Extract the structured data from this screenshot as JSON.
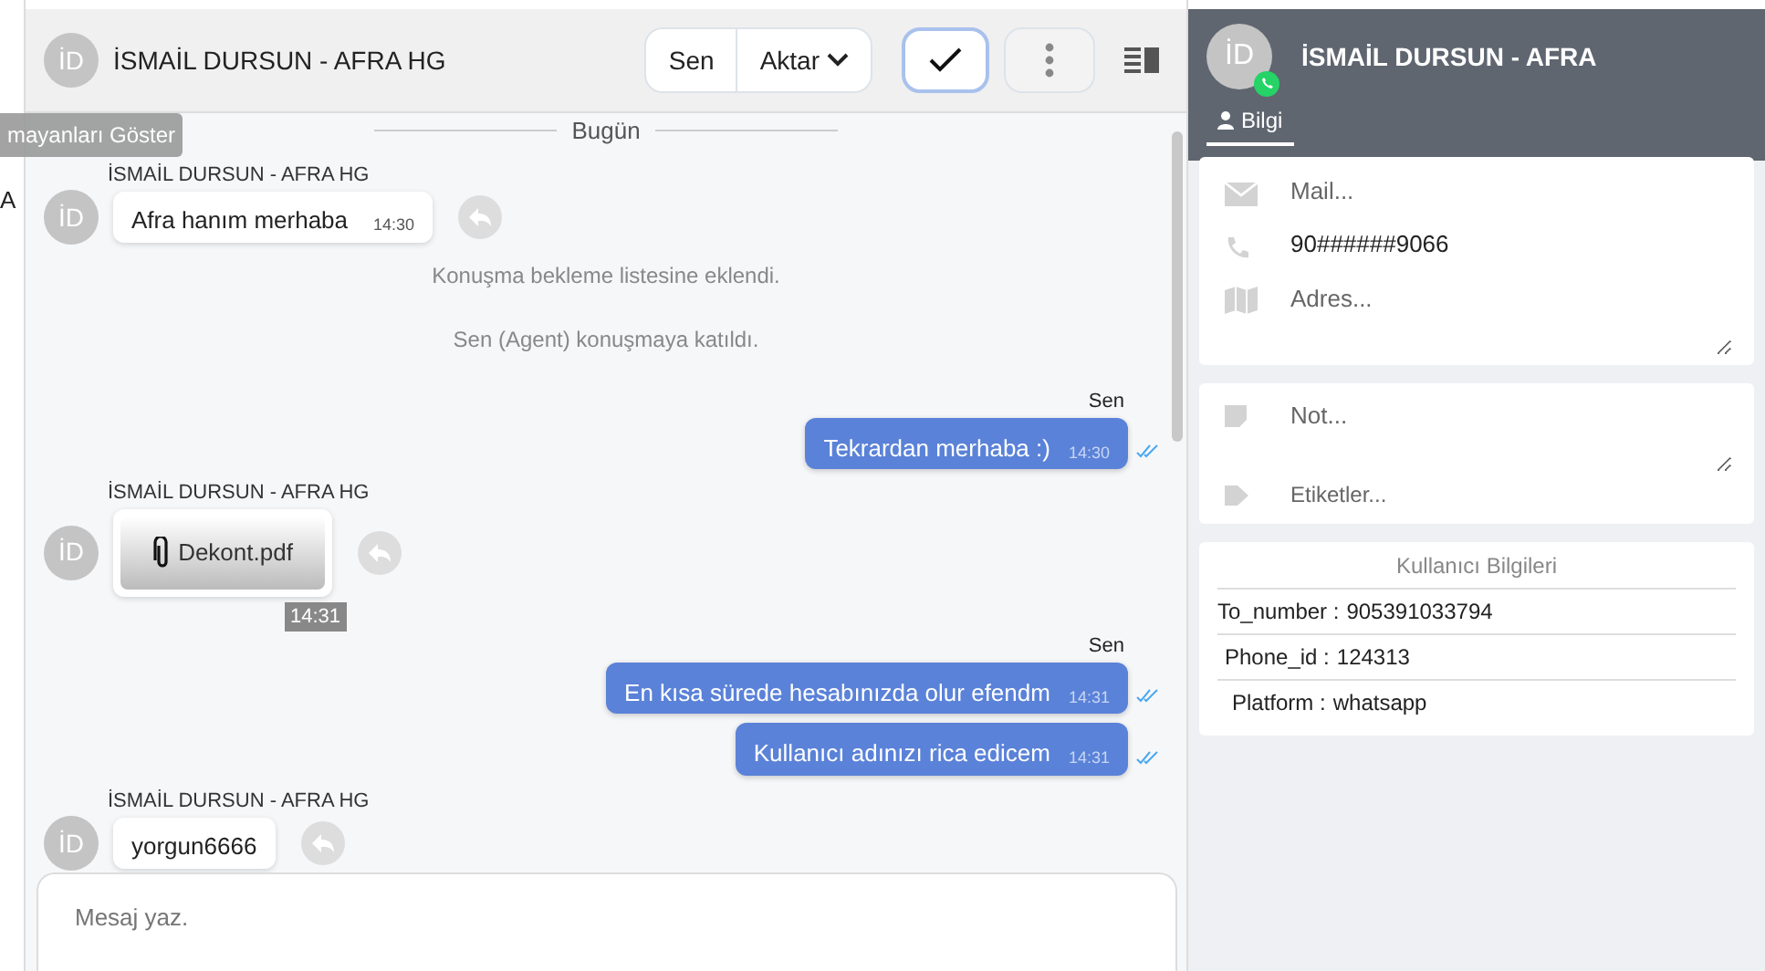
{
  "left_strip": {
    "tooltip": "mayanları Göster",
    "letter": "A"
  },
  "chat_header": {
    "avatar": "İD",
    "title": "İSMAİL DURSUN - AFRA HG",
    "buttons": [
      {
        "kind": "text",
        "label": "Sen"
      },
      {
        "kind": "dropdown",
        "label": "Aktar"
      },
      {
        "kind": "check"
      },
      {
        "kind": "more"
      },
      {
        "kind": "panel"
      }
    ]
  },
  "messages": [
    {
      "kind": "divider",
      "text": "Bugün"
    },
    {
      "kind": "incoming",
      "avatar": "İD",
      "sender": "İSMAİL DURSUN - AFRA HG",
      "text": "Afra hanım merhaba",
      "time": "14:30"
    },
    {
      "kind": "system",
      "text": "Konuşma bekleme listesine eklendi."
    },
    {
      "kind": "system",
      "text": "Sen (Agent) konuşmaya katıldı."
    },
    {
      "kind": "outgoing",
      "sender": "Sen",
      "text": "Tekrardan merhaba :)",
      "time": "14:30",
      "read": true
    },
    {
      "kind": "file",
      "avatar": "İD",
      "sender": "İSMAİL DURSUN - AFRA HG",
      "file": "Dekont.pdf",
      "time": "14:31"
    },
    {
      "kind": "outgoing",
      "sender": "Sen",
      "text": "En kısa sürede hesabınızda olur efendm",
      "time": "14:31",
      "read": true
    },
    {
      "kind": "outgoing",
      "text": "Kullanıcı adınızı rica edicem",
      "time": "14:31",
      "read": true
    },
    {
      "kind": "incoming",
      "avatar": "İD",
      "sender": "İSMAİL DURSUN - AFRA HG",
      "text": "yorgun6666"
    }
  ],
  "composer": {
    "placeholder": "Mesaj yaz."
  },
  "contact_panel": {
    "avatar": "İD",
    "name": "İSMAİL DURSUN - AFRA",
    "tabs": [
      {
        "label": "Bilgi",
        "selected": true
      }
    ],
    "fields": [
      {
        "kind": "mail",
        "placeholder": "Mail..."
      },
      {
        "kind": "phone",
        "value": "90######9066"
      },
      {
        "kind": "address",
        "placeholder": "Adres..."
      }
    ],
    "note": {
      "placeholder": "Not..."
    },
    "tags": {
      "placeholder": "Etiketler..."
    },
    "user_info": {
      "title": "Kullanıcı Bilgileri",
      "rows": [
        {
          "label": "To_number :",
          "value": "905391033794"
        },
        {
          "label": "Phone_id :",
          "value": "124313"
        },
        {
          "label": "Platform :",
          "value": "whatsapp"
        }
      ]
    }
  }
}
